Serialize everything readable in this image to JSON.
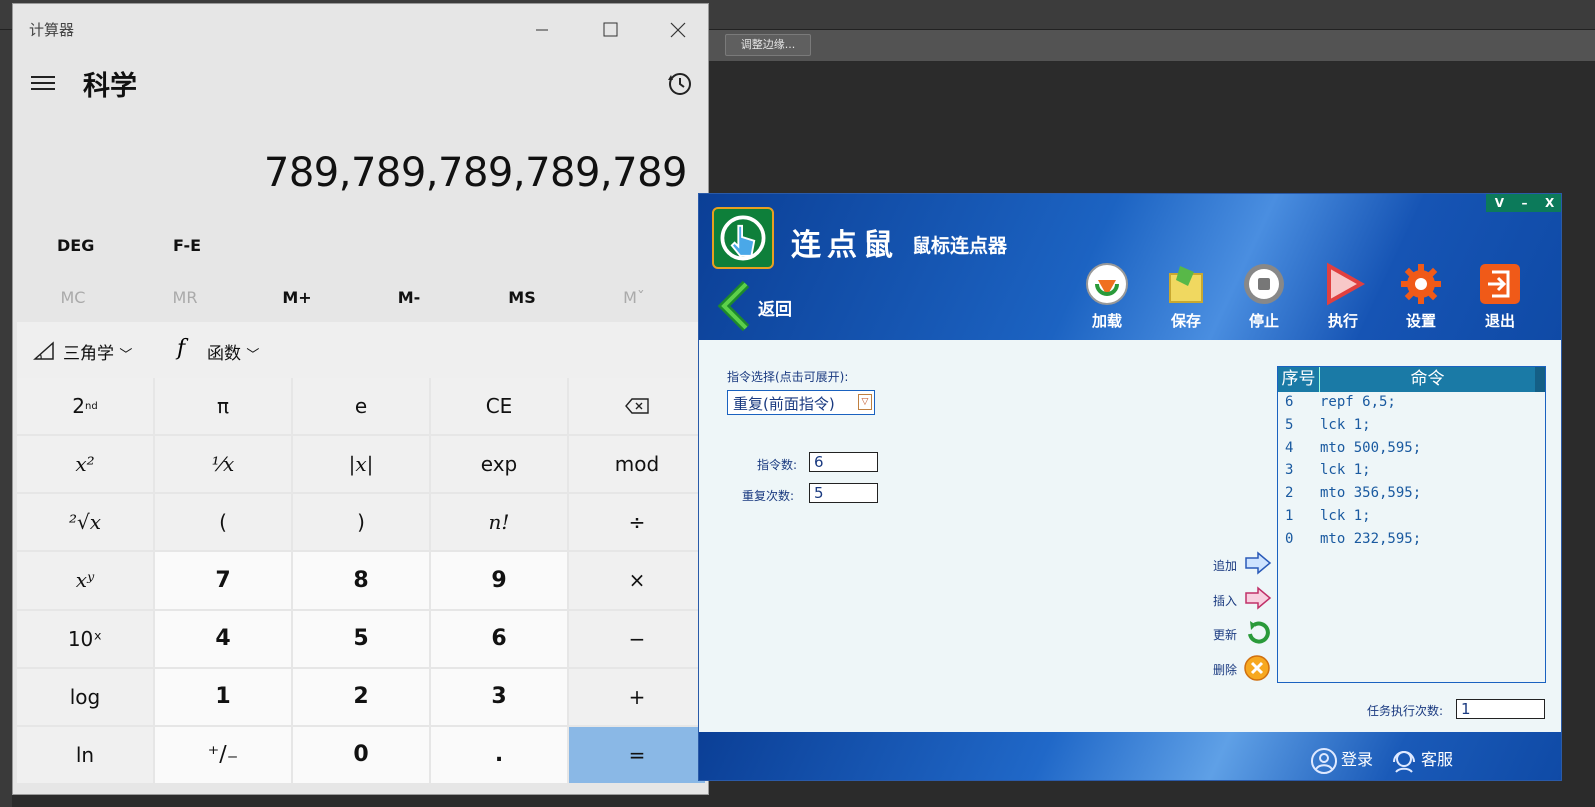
{
  "background": {
    "edge_button_label": "调整边缘..."
  },
  "calculator": {
    "window_title": "计算器",
    "mode_title": "科学",
    "display": "789,789,789,789,789",
    "angle_mode": "DEG",
    "fe_label": "F-E",
    "memory": [
      "MC",
      "MR",
      "M+",
      "M-",
      "MS",
      "Mˇ"
    ],
    "trig_label": "三角学",
    "function_label": "函数",
    "keys": [
      [
        "2nd",
        "π",
        "e",
        "CE",
        "⌫"
      ],
      [
        "x²",
        "⅟x",
        "|x|",
        "exp",
        "mod"
      ],
      [
        "²√x",
        "(",
        ")",
        "n!",
        "÷"
      ],
      [
        "xʸ",
        "7",
        "8",
        "9",
        "×"
      ],
      [
        "10ˣ",
        "4",
        "5",
        "6",
        "−"
      ],
      [
        "log",
        "1",
        "2",
        "3",
        "+"
      ],
      [
        "ln",
        "⁺∕₋",
        "0",
        ".",
        "="
      ]
    ]
  },
  "clicker": {
    "window_controls": [
      "V",
      "–",
      "X"
    ],
    "app_name": "连点鼠",
    "subtitle": "鼠标连点器",
    "back_label": "返回",
    "toolbar": {
      "load": "加载",
      "save": "保存",
      "stop": "停止",
      "run": "执行",
      "settings": "设置",
      "exit": "退出"
    },
    "command_select_label": "指令选择(点击可展开):",
    "command_select_value": "重复(前面指令)",
    "command_count_label": "指令数:",
    "command_count_value": "6",
    "repeat_count_label": "重复次数:",
    "repeat_count_value": "5",
    "list_headers": {
      "index": "序号",
      "command": "命令"
    },
    "commands": [
      {
        "index": "6",
        "cmd": "repf 6,5;"
      },
      {
        "index": "5",
        "cmd": "lck 1;"
      },
      {
        "index": "4",
        "cmd": "mto 500,595;"
      },
      {
        "index": "3",
        "cmd": "lck 1;"
      },
      {
        "index": "2",
        "cmd": "mto 356,595;"
      },
      {
        "index": "1",
        "cmd": "lck 1;"
      },
      {
        "index": "0",
        "cmd": "mto 232,595;"
      }
    ],
    "actions": {
      "add": "追加",
      "insert": "插入",
      "update": "更新",
      "delete": "删除"
    },
    "task_runs_label": "任务执行次数:",
    "task_runs_value": "1",
    "footer": {
      "login": "登录",
      "service": "客服"
    }
  }
}
